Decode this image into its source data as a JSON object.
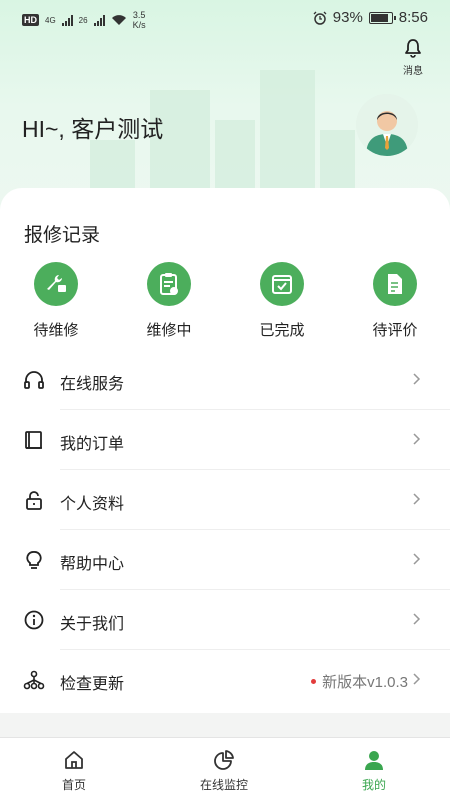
{
  "status_bar": {
    "hd": "HD",
    "sig1": "4G",
    "sig2": "26",
    "speed_value": "3.5",
    "speed_unit": "K/s",
    "battery_pct": "93%",
    "battery_level": 0.93,
    "time": "8:56"
  },
  "header": {
    "message_label": "消息",
    "greeting": "HI~, 客户测试"
  },
  "repair": {
    "title": "报修记录",
    "items": [
      {
        "label": "待维修",
        "icon": "repair-wrench-icon"
      },
      {
        "label": "维修中",
        "icon": "clipboard-edit-icon"
      },
      {
        "label": "已完成",
        "icon": "calendar-check-icon"
      },
      {
        "label": "待评价",
        "icon": "document-edit-icon"
      }
    ]
  },
  "menu": [
    {
      "label": "在线服务",
      "icon": "headset-icon"
    },
    {
      "label": "我的订单",
      "icon": "book-icon"
    },
    {
      "label": "个人资料",
      "icon": "lock-icon"
    },
    {
      "label": "帮助中心",
      "icon": "lightbulb-icon"
    },
    {
      "label": "关于我们",
      "icon": "info-icon"
    },
    {
      "label": "检查更新",
      "icon": "hierarchy-icon",
      "extra": "新版本v1.0.3"
    }
  ],
  "tabs": [
    {
      "label": "首页",
      "icon": "home-icon"
    },
    {
      "label": "在线监控",
      "icon": "pie-chart-icon"
    },
    {
      "label": "我的",
      "icon": "user-icon",
      "active": true
    }
  ],
  "colors": {
    "accent": "#4cae5c",
    "active_tab": "#3aa64f",
    "update_dot": "#e23b3b"
  }
}
